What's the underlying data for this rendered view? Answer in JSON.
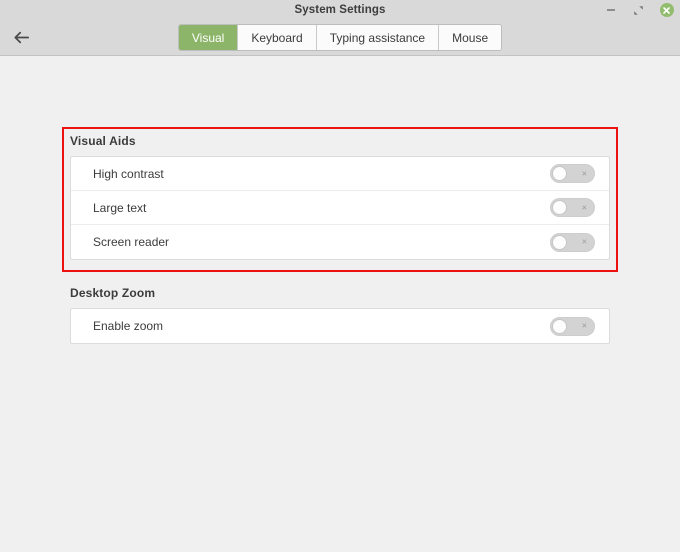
{
  "window": {
    "title": "System Settings",
    "controls": {
      "minimize": "minimize",
      "maximize": "maximize",
      "close": "close"
    }
  },
  "header": {
    "back_label": "Back",
    "tabs": [
      {
        "label": "Visual",
        "active": true
      },
      {
        "label": "Keyboard",
        "active": false
      },
      {
        "label": "Typing assistance",
        "active": false
      },
      {
        "label": "Mouse",
        "active": false
      }
    ]
  },
  "sections": [
    {
      "title": "Visual Aids",
      "rows": [
        {
          "label": "High contrast",
          "toggle": "off",
          "toggle_mark": "×"
        },
        {
          "label": "Large text",
          "toggle": "off",
          "toggle_mark": "×"
        },
        {
          "label": "Screen reader",
          "toggle": "off",
          "toggle_mark": "×"
        }
      ]
    },
    {
      "title": "Desktop Zoom",
      "rows": [
        {
          "label": "Enable zoom",
          "toggle": "off",
          "toggle_mark": "×"
        }
      ]
    }
  ],
  "highlight": {
    "color": "#ee1111",
    "target": "Visual Aids"
  },
  "colors": {
    "accent_green": "#8cb569",
    "close_button_green": "#93bd6e",
    "titlebar": "#d9d9d9",
    "page_background": "#f0f0f0",
    "card": "#ffffff"
  }
}
